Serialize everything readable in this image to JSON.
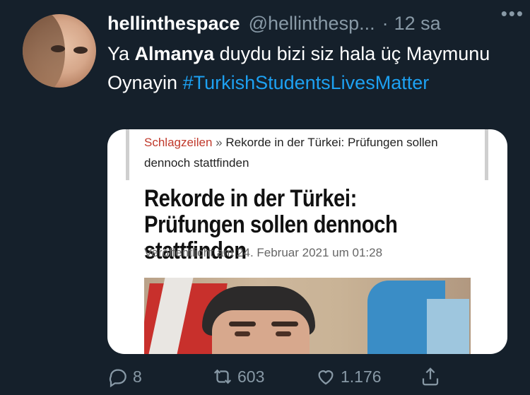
{
  "tweet": {
    "display_name": "hellinthespace",
    "handle": "@hellinthesp...",
    "separator": "·",
    "time": "12 sa",
    "more_icon": "more-dots-icon",
    "text": {
      "part1": "Ya ",
      "bold": "Almanya",
      "part2": " duydu bizi siz hala üç Maymunu",
      "part3": "Oynayin ",
      "hashtag": "#TurkishStudentsLivesMatter"
    },
    "card": {
      "breadcrumb_link": "Schlagzeilen",
      "breadcrumb_sep": "»",
      "breadcrumb_rest": "Rekorde in der Türkei: Prüfungen sollen dennoch stattfinden",
      "headline": "Rekorde in der Türkei: Prüfungen sollen dennoch stattfinden",
      "published": "Veröffentlicht am 24. Februar 2021 um 01:28"
    },
    "actions": {
      "reply_count": "8",
      "retweet_count": "603",
      "like_count": "1.176",
      "share_icon": "share-icon"
    }
  },
  "colors": {
    "background": "#15202b",
    "secondary_text": "#8899a6",
    "link": "#1da1f2"
  }
}
